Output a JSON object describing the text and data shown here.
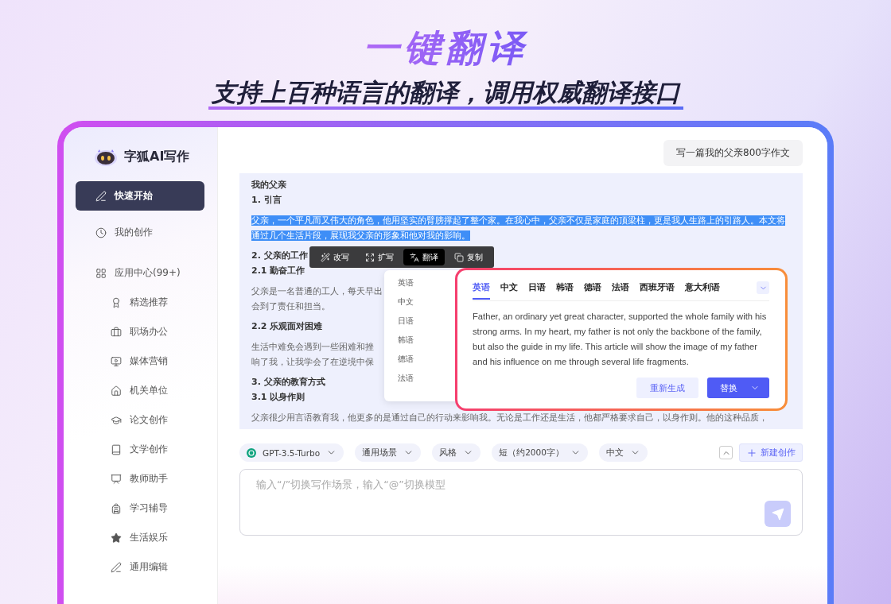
{
  "hero": {
    "title": "一键翻译",
    "subtitle": "支持上百种语言的翻译，调用权威翻译接口"
  },
  "sidebar": {
    "brand": "字狐AI写作",
    "items": [
      {
        "label": "快速开始",
        "selected": true
      },
      {
        "label": "我的创作",
        "selected": false
      },
      {
        "label": "应用中心(99+)",
        "selected": false,
        "children": [
          {
            "label": "精选推荐",
            "selected": false
          },
          {
            "label": "职场办公",
            "selected": false
          },
          {
            "label": "媒体营销",
            "selected": false
          },
          {
            "label": "机关单位",
            "selected": false
          },
          {
            "label": "论文创作",
            "selected": false
          },
          {
            "label": "文学创作",
            "selected": false
          },
          {
            "label": "教师助手",
            "selected": false
          },
          {
            "label": "学习辅导",
            "selected": false
          },
          {
            "label": "生活娱乐",
            "selected": false
          },
          {
            "label": "通用编辑",
            "selected": false
          }
        ]
      }
    ]
  },
  "prompt": "写一篇我的父亲800字作文",
  "article": [
    {
      "kind": "title",
      "text": "我的父亲",
      "selected": false
    },
    {
      "kind": "heading",
      "text": "1. 引言",
      "selected": false
    },
    {
      "kind": "para",
      "text": "父亲，一个平凡而又伟大的角色，他用坚实的臂膀撑起了整个家。在我心中，父亲不仅是家庭的顶梁柱，更是我人生路上的引路人。本文将通过几个生活片段，展现我父亲的形象和他对我的影响。",
      "selected": true
    },
    {
      "kind": "heading",
      "text": "2. 父亲的工作",
      "selected": false
    },
    {
      "kind": "heading",
      "text": "2.1 勤奋工作",
      "selected": false
    },
    {
      "kind": "para",
      "lines": [
        "父亲是一名普通的工人，每天早出",
        "会到了责任和担当。"
      ],
      "selected": false
    },
    {
      "kind": "heading",
      "text": "2.2 乐观面对困难",
      "selected": false
    },
    {
      "kind": "para",
      "lines": [
        "生活中难免会遇到一些困难和挫",
        "响了我，让我学会了在逆境中保"
      ],
      "selected": false
    },
    {
      "kind": "heading",
      "text": "3. 父亲的教育方式",
      "selected": false
    },
    {
      "kind": "heading",
      "text": "3.1 以身作则",
      "selected": false
    },
    {
      "kind": "para",
      "text": "父亲很少用言语教育我，他更多的是通过自己的行动来影响我。无论是工作还是生活，他都严格要求自己，以身作则。他的这种品质，",
      "selected": false
    }
  ],
  "toolbar": [
    {
      "label": "改写",
      "selected": false
    },
    {
      "label": "扩写",
      "selected": false
    },
    {
      "label": "翻译",
      "selected": true
    },
    {
      "label": "复制",
      "selected": false
    }
  ],
  "language_menu": [
    "英语",
    "中文",
    "日语",
    "韩语",
    "德语",
    "法语"
  ],
  "translation": {
    "tabs": [
      {
        "label": "英语",
        "selected": true
      },
      {
        "label": "中文",
        "selected": false
      },
      {
        "label": "日语",
        "selected": false
      },
      {
        "label": "韩语",
        "selected": false
      },
      {
        "label": "德语",
        "selected": false
      },
      {
        "label": "法语",
        "selected": false
      },
      {
        "label": "西班牙语",
        "selected": false
      },
      {
        "label": "意大利语",
        "selected": false
      }
    ],
    "text": "Father, an ordinary yet great character, supported the whole family with his strong arms. In my heart, my father is not only the backbone of the family, but also the guide in my life. This article will show the image of my father and his influence on me through several life fragments.",
    "regenerate": "重新生成",
    "replace": "替换"
  },
  "composer": {
    "options": [
      {
        "kind": "model",
        "label": "GPT-3.5-Turbo"
      },
      {
        "kind": "plain",
        "label": "通用场景"
      },
      {
        "kind": "plain",
        "label": "风格"
      },
      {
        "kind": "plain",
        "label": "短（约2000字）"
      },
      {
        "kind": "plain",
        "label": "中文"
      }
    ],
    "new_button": "新建创作",
    "placeholder": "输入“/”切换写作场景，输入“@”切换模型"
  }
}
